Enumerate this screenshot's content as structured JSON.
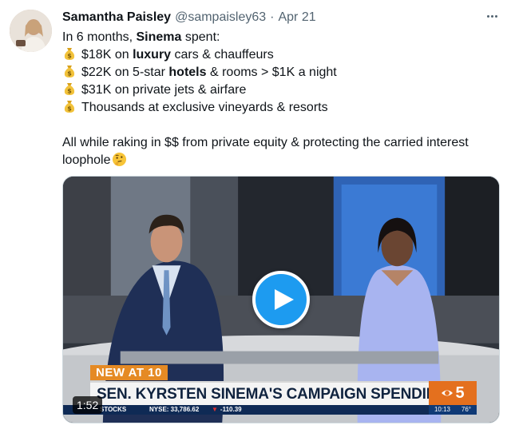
{
  "tweet": {
    "author_name": "Samantha Paisley",
    "handle": "@sampaisley63",
    "separator": "·",
    "date": "Apr 21",
    "lines": [
      {
        "prefix": "In 6 months, ",
        "bold": "Sinema",
        "suffix": " spent:"
      },
      {
        "prefix": "$18K on ",
        "bold": "luxury",
        "suffix": " cars & chauffeurs"
      },
      {
        "prefix": "$22K on 5-star ",
        "bold": "hotels",
        "suffix": " & rooms > $1K a night"
      },
      {
        "prefix": "$31K on private jets & airfare",
        "bold": "",
        "suffix": ""
      },
      {
        "prefix": "Thousands at exclusive vineyards & resorts",
        "bold": "",
        "suffix": ""
      }
    ],
    "closing_line1": "All while raking in $$ from private equity & protecting the carried interest",
    "closing_line2": "loophole",
    "icons": {
      "list_bullet": "money-bag-icon",
      "closing_emoji": "thinking-face-icon",
      "more": "more-options-icon"
    }
  },
  "video": {
    "tag": "NEW AT 10",
    "headline": "SEN. KYRSTEN SINEMA'S CAMPAIGN SPENDING",
    "station_logo": "5",
    "time": "10:13",
    "temperature": "76°",
    "ticker_label": "STOCKS",
    "ticker_index": "NYSE: 33,786.62",
    "ticker_change": "-110.39",
    "duration": "1:52",
    "play_icon": "play-icon"
  },
  "colors": {
    "accent": "#1d9bf0",
    "tag": "#e58a24",
    "logo": "#e4701e",
    "ticker": "#0f2a55"
  }
}
